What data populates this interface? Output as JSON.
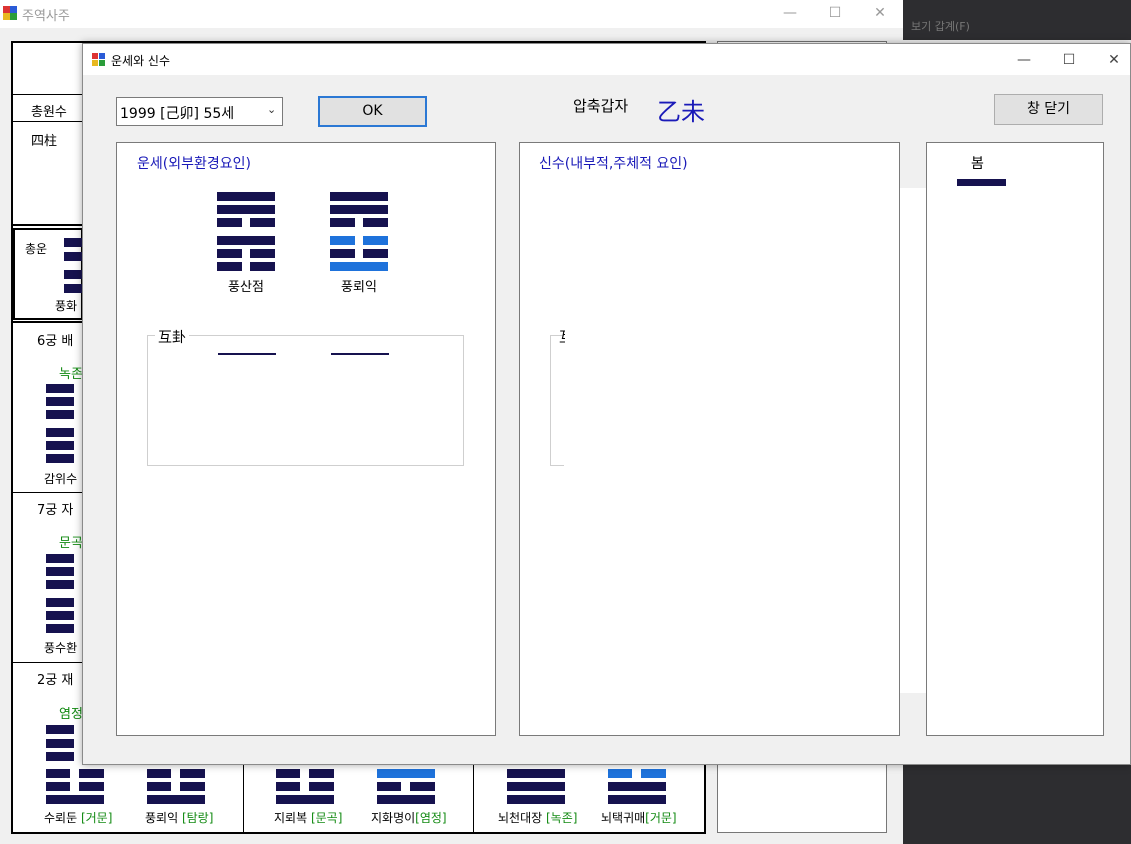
{
  "bg_window": {
    "title": "주역사주",
    "partial_menu": "보기 갑계(F)",
    "row_label_1": "총원수",
    "row_label_2": "四柱",
    "total_label": "총운",
    "total_name": "풍화",
    "palace_6": "6궁 배",
    "palace_6_star": "녹존",
    "palace_6_name": "감위수",
    "palace_7": "7궁 자",
    "palace_7_star": "문곡",
    "palace_7_name": "풍수환",
    "palace_2": "2궁 재",
    "palace_2_star": "염정",
    "bottom_hexes": [
      {
        "name": "수뢰둔",
        "tag": "[거문]"
      },
      {
        "name": "풍뢰익",
        "tag": "[탐랑]"
      },
      {
        "name": "지뢰복",
        "tag": "[문곡]"
      },
      {
        "name": "지화명이",
        "tag": "[염정]"
      },
      {
        "name": "뇌천대장",
        "tag": "[녹존]"
      },
      {
        "name": "뇌택귀매",
        "tag": "[거문]"
      }
    ]
  },
  "dialog": {
    "title": "운세와 신수",
    "year_select": "1999 [己卯] 55세",
    "ok_label": "OK",
    "ganji_label": "압축갑자",
    "ganji_value": "乙未",
    "close_label": "창 닫기",
    "fortune_panel": {
      "title": "운세(외부환경요인)",
      "hex1_name": "풍산점",
      "hex2_name": "풍뢰익",
      "mutual_label": "互卦"
    },
    "self_panel": {
      "title": "신수(내부적,주체적 요인)",
      "cut_label": "互"
    },
    "season_panel": {
      "label": "봄"
    }
  },
  "colors": {
    "yao_dark": "#16124f",
    "yao_changing": "#1e72db",
    "panel_title": "#1a1ab8",
    "ganji": "#1a1ab8",
    "star_label": "#128a12"
  }
}
